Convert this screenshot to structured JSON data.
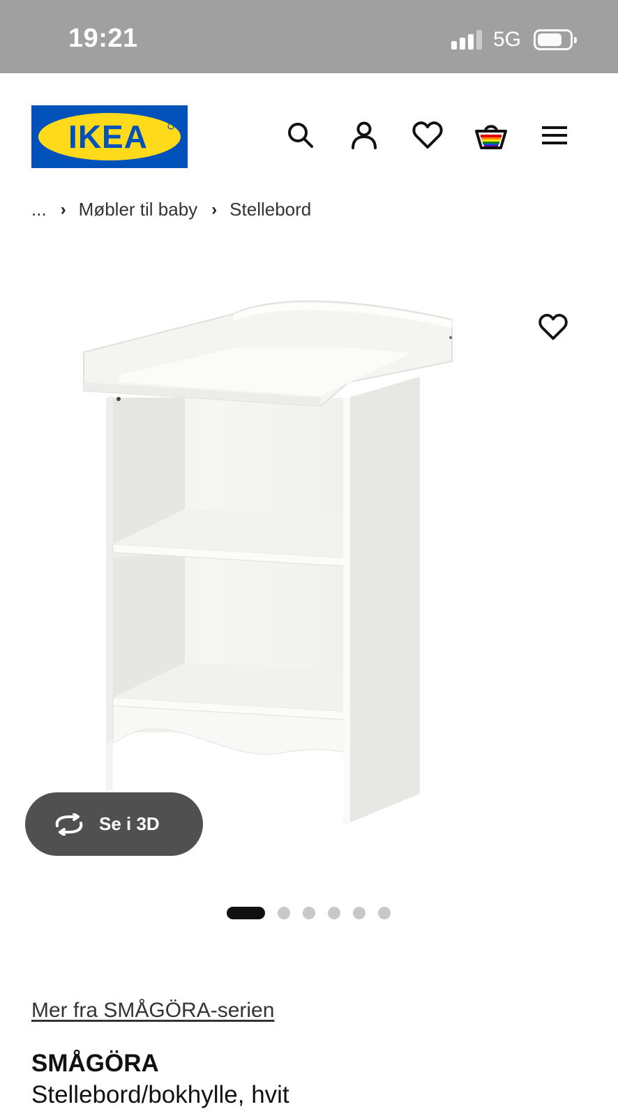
{
  "status_bar": {
    "time": "19:21",
    "network": "5G"
  },
  "header": {
    "logo_text": "IKEA",
    "icons": [
      "search-icon",
      "account-icon",
      "heart-icon",
      "shopping-bag-icon",
      "menu-icon"
    ],
    "colors": {
      "brand_blue": "#0051ba",
      "brand_yellow": "#ffda1a"
    }
  },
  "breadcrumb": {
    "ellipsis": "...",
    "items": [
      "Møbler til baby",
      "Stellebord"
    ]
  },
  "gallery": {
    "view_3d_label": "Se i 3D",
    "image_count": 6,
    "active_index": 0
  },
  "product": {
    "series_link": "Mer fra SMÅGÖRA-serien",
    "name": "SMÅGÖRA",
    "description": "Stellebord/bokhylle, hvit"
  }
}
